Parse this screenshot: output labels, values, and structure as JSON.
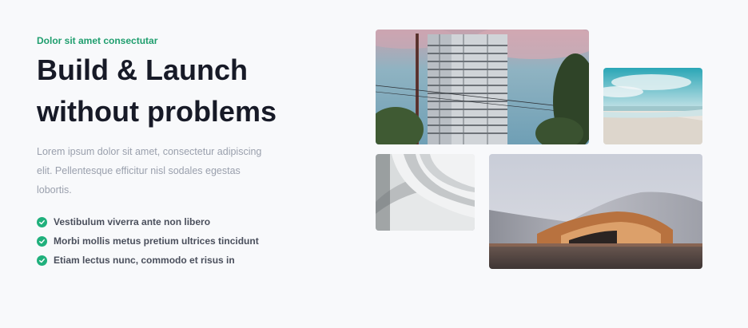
{
  "hero": {
    "eyebrow": "Dolor sit amet consectutar",
    "title_line1": "Build & Launch",
    "title_line2": "without problems",
    "description": "Lorem ipsum dolor sit amet, consectetur adipiscing elit. Pellentesque efficitur nisl sodales egestas lobortis.",
    "features": [
      "Vestibulum viverra ante non libero",
      "Morbi mollis metus pretium ultrices tincidunt",
      "Etiam lectus nunc, commodo et risus in"
    ]
  },
  "gallery": {
    "images": [
      "building-under-construction-photo",
      "beach-photo",
      "white-architecture-photo",
      "wavy-roof-building-photo"
    ]
  },
  "colors": {
    "background": "#f8f9fb",
    "accent": "#1f9e6e",
    "heading": "#171a27",
    "body_text": "#9aa0ad"
  }
}
